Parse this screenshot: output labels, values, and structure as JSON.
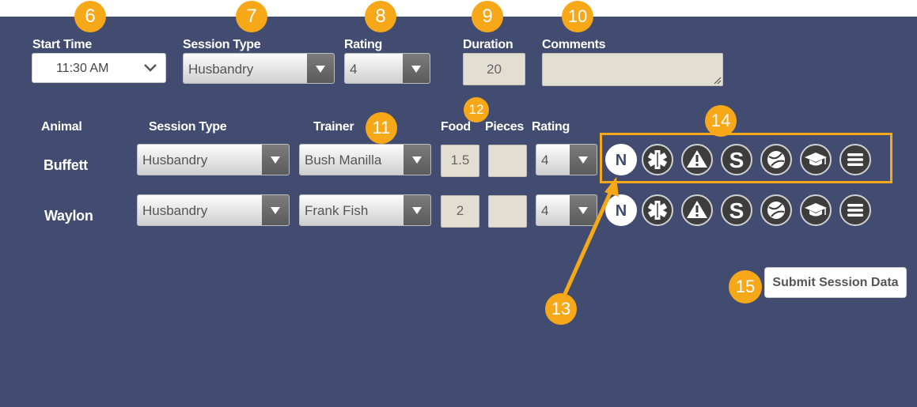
{
  "header": {
    "start_time_label": "Start Time",
    "start_time_value": "11:30 AM",
    "session_type_label": "Session Type",
    "session_type_value": "Husbandry",
    "rating_label": "Rating",
    "rating_value": "4",
    "duration_label": "Duration",
    "duration_value": "20",
    "comments_label": "Comments",
    "comments_value": ""
  },
  "columns": {
    "animal": "Animal",
    "session_type": "Session Type",
    "trainer": "Trainer",
    "food": "Food",
    "pieces": "Pieces",
    "rating": "Rating"
  },
  "rows": [
    {
      "animal": "Buffett",
      "session_type": "Husbandry",
      "trainer": "Bush Manilla",
      "food": "1.5",
      "pieces": "",
      "rating": "4"
    },
    {
      "animal": "Waylon",
      "session_type": "Husbandry",
      "trainer": "Frank Fish",
      "food": "2",
      "pieces": "",
      "rating": "4"
    }
  ],
  "row_icons": [
    "note-icon",
    "medical-icon",
    "warning-icon",
    "s-icon",
    "ball-icon",
    "graduation-cap-icon",
    "menu-icon"
  ],
  "note_icon_letter": "N",
  "submit_label": "Submit Session Data",
  "callouts": {
    "c6": "6",
    "c7": "7",
    "c8": "8",
    "c9": "9",
    "c10": "10",
    "c11": "11",
    "c12": "12",
    "c13": "13",
    "c14": "14",
    "c15": "15"
  },
  "colors": {
    "background": "#414c70",
    "callout": "#f7a818",
    "input_fill": "#e3ded2",
    "icon_dark": "#3d3d3d"
  }
}
